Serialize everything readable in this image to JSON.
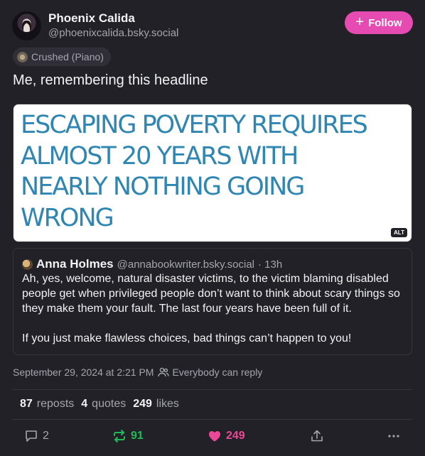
{
  "author": {
    "name": "Phoenix Calida",
    "handle": "@phoenixcalida.bsky.social",
    "follow_label": "Follow"
  },
  "label_chip": "Crushed (Piano)",
  "post": {
    "text": "Me, remembering this headline",
    "image": {
      "headline_lines": [
        "ESCAPING POVERTY REQUIRES",
        "ALMOST 20 YEARS WITH",
        "NEARLY NOTHING GOING",
        "WRONG"
      ],
      "alt_badge": "ALT"
    }
  },
  "quote": {
    "name": "Anna Holmes",
    "handle": "@annabookwriter.bsky.social",
    "time": "· 13h",
    "paragraph1": "Ah, yes, welcome, natural disaster victims, to the victim blaming disabled people get when privileged people don’t want to think about scary things so they make them your fault. The last four years have been full of it.",
    "paragraph2": "If you just make flawless choices, bad things can’t happen to you!"
  },
  "meta": {
    "timestamp": "September 29, 2024 at 2:21 PM",
    "reply_setting": "Everybody can reply"
  },
  "stats": {
    "reposts_count": "87",
    "reposts_label": "reposts",
    "quotes_count": "4",
    "quotes_label": "quotes",
    "likes_count": "249",
    "likes_label": "likes"
  },
  "actions": {
    "reply_count": "2",
    "repost_count": "91",
    "like_count": "249"
  },
  "colors": {
    "accent": "#e64bb2",
    "repost_active": "#20bc59",
    "like_active": "#ec4899",
    "headline_blue": "#2f86b2"
  }
}
